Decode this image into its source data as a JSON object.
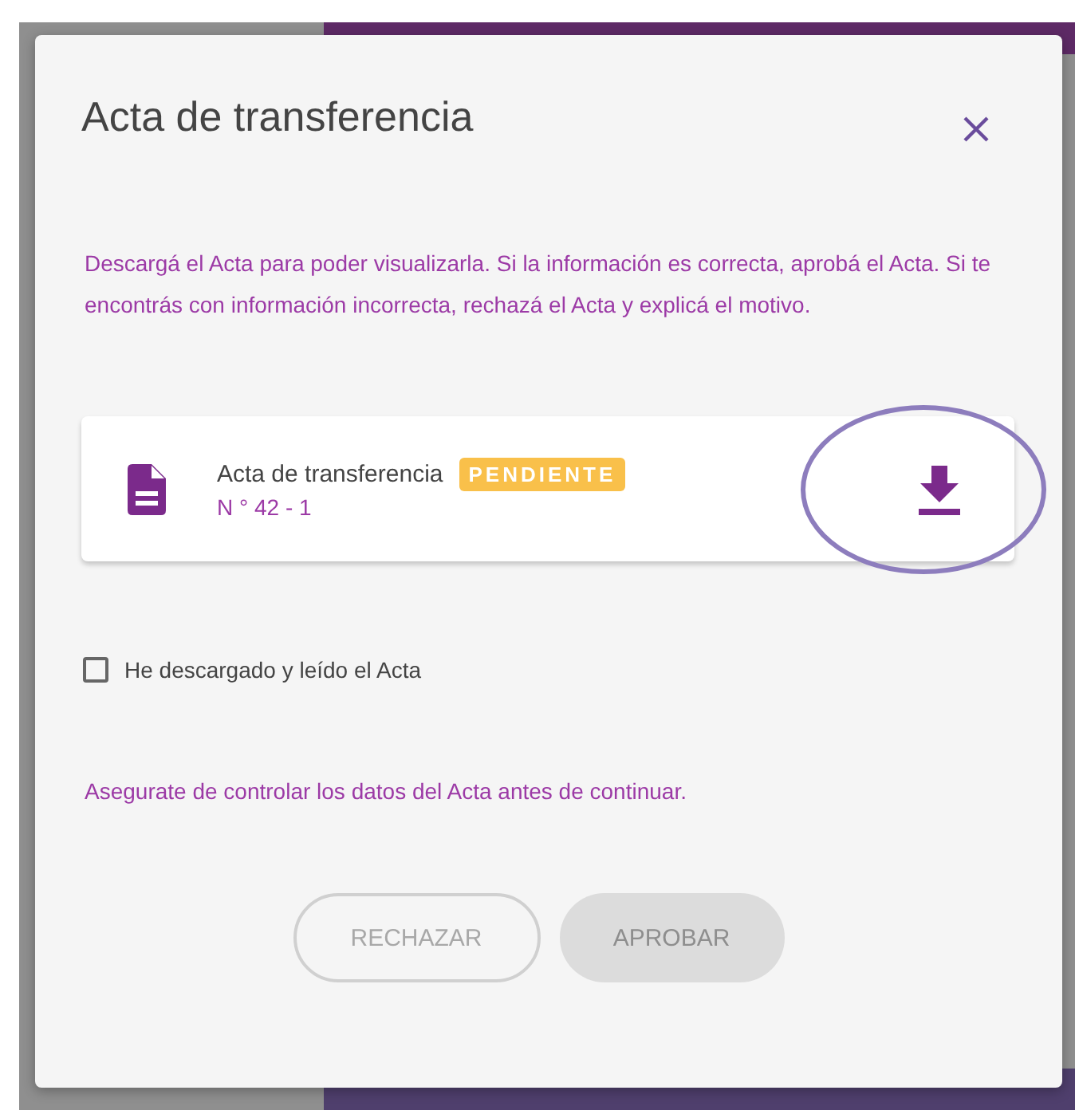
{
  "modal": {
    "title": "Acta de transferencia",
    "description": "Descargá el Acta para poder visualizarla. Si la información es correcta, aprobá el Acta. Si te encontrás con información incorrecta, rechazá el Acta y explicá el motivo.",
    "document": {
      "title": "Acta de transferencia",
      "badge": "PENDIENTE",
      "number": "N ° 42 - 1",
      "download_highlighted": true
    },
    "checkbox": {
      "label": "He descargado y leído el Acta",
      "checked": false
    },
    "note": "Asegurate de controlar los datos del Acta antes de continuar.",
    "buttons": [
      {
        "label": "RECHAZAR",
        "kind": "outline",
        "disabled": true
      },
      {
        "label": "APROBAR",
        "kind": "filled",
        "disabled": true
      }
    ]
  }
}
